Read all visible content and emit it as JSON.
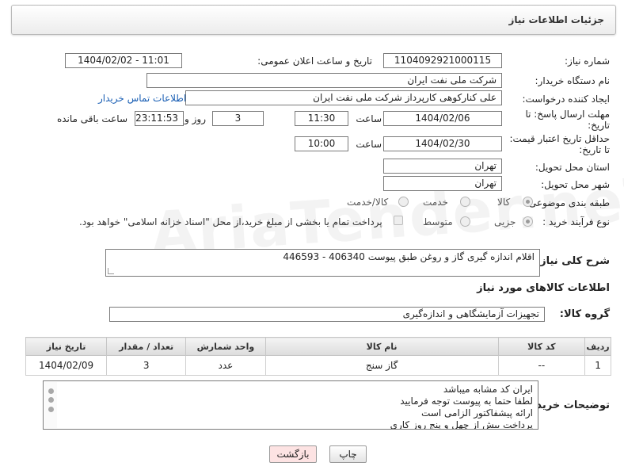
{
  "header": {
    "title": "جزئیات اطلاعات نیاز"
  },
  "form": {
    "need_number_label": "شماره نیاز:",
    "need_number": "1104092921000115",
    "announce_label": "تاریخ و ساعت اعلان عمومی:",
    "announce_value": "1404/02/02 - 11:01",
    "buyer_org_label": "نام دستگاه خریدار:",
    "buyer_org": "شرکت ملی نفت ایران",
    "creator_label": "ایجاد کننده درخواست:",
    "creator": "علی کنارکوهی کارپرداز شرکت ملی نفت ایران",
    "contact_link": "اطلاعات تماس خریدار",
    "deadline_label_1": "مهلت ارسال پاسخ: تا",
    "deadline_label_2": "تاریخ:",
    "deadline_date": "1404/02/06",
    "time_label": "ساعت",
    "deadline_time": "11:30",
    "days_value": "3",
    "days_label": "روز و",
    "remaining_time": "23:11:53",
    "remaining_label": "ساعت باقی مانده",
    "validity_label_1": "حداقل تاریخ اعتبار قیمت:",
    "validity_label_2": "تا تاریخ:",
    "validity_date": "1404/02/30",
    "validity_time": "10:00",
    "province_label": "استان محل تحویل:",
    "province": "تهران",
    "city_label": "شهر محل تحویل:",
    "city": "تهران",
    "category_label": "طبقه بندی موضوعی:",
    "category_options": [
      "کالا",
      "خدمت",
      "کالا/خدمت"
    ],
    "category_selected": "کالا",
    "process_label": "نوع فرآیند خرید :",
    "process_options": [
      "جزیی",
      "متوسط"
    ],
    "process_selected": "جزیی",
    "payment_note": "پرداخت تمام یا بخشی از مبلغ خرید،از محل \"اسناد خزانه اسلامی\" خواهد بود.",
    "description_label": "شرح کلی نیاز:",
    "description": "اقلام اندازه گیری گاز و روغن طبق پیوست 406340 - 446593",
    "goods_info_title": "اطلاعات کالاهای مورد نیاز",
    "goods_group_label": "گروه کالا:",
    "goods_group": "تجهیزات آزمایشگاهی و اندازه‌گیری"
  },
  "table": {
    "headers": [
      "ردیف",
      "کد کالا",
      "نام کالا",
      "واحد شمارش",
      "تعداد / مقدار",
      "تاریخ نیاز"
    ],
    "rows": [
      [
        "1",
        "--",
        "گاز سنج",
        "عدد",
        "3",
        "1404/02/09"
      ]
    ]
  },
  "notes": {
    "label": "توضیحات خریدار:",
    "lines": [
      "ایران کد مشابه میباشد",
      "لطفا حتما به پیوست توجه فرمایید",
      "ارائه پیشفاکتور الزامی است",
      "پرداخت بیش از چهل و پنج روز کاری"
    ]
  },
  "buttons": {
    "print": "چاپ",
    "back": "بازگشت"
  },
  "watermark": "AriaTender.neT",
  "colors": {
    "link": "#1a5fb4",
    "back_button_bg": "#fde3e3"
  }
}
